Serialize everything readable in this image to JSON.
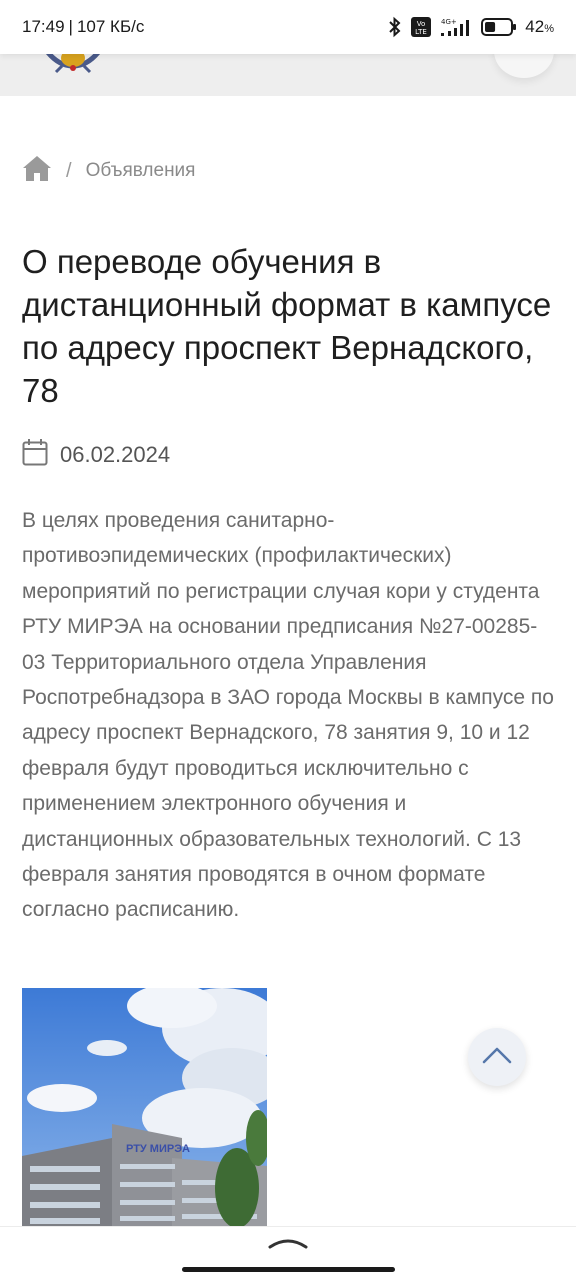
{
  "status_bar": {
    "time": "17:49",
    "separator": "|",
    "speed": "107 КБ/с",
    "network_badge": "Vo LTE",
    "network_type": "4G+",
    "battery_percent": "42",
    "battery_unit": "%",
    "battery_level": 0.42
  },
  "header": {
    "logo_icon": "university-crest-icon",
    "menu_icon": "menu-button"
  },
  "breadcrumb": {
    "home_icon": "home-icon",
    "separator": "/",
    "current": "Объявления"
  },
  "article": {
    "title": "О переводе обучения в дистанционный формат в кампусе по адресу проспект Вернадского, 78",
    "date": "06.02.2024",
    "body": "В целях проведения санитарно-противоэпидемических (профилактических) мероприятий по регистрации случая кори у студента РТУ МИРЭА на основании предписания №27-00285-03 Территориального отдела Управления Роспотребнадзора в ЗАО города Москвы в кампусе по адресу проспект Вернадского, 78 занятия 9, 10 и 12 февраля будут проводиться исключительно с применением электронного обучения и дистанционных образовательных технологий. С 13 февраля занятия проводятся в очном формате согласно расписанию.",
    "image_sign": "РТУ МИРЭА"
  },
  "scroll_top": {
    "icon": "chevron-up-icon"
  },
  "colors": {
    "title_text": "#1f1f1f",
    "body_text": "#6b6b6b",
    "breadcrumb_text": "#8a8a8a",
    "header_bg": "#eeeeee",
    "sign_blue": "#3a4fa8"
  }
}
